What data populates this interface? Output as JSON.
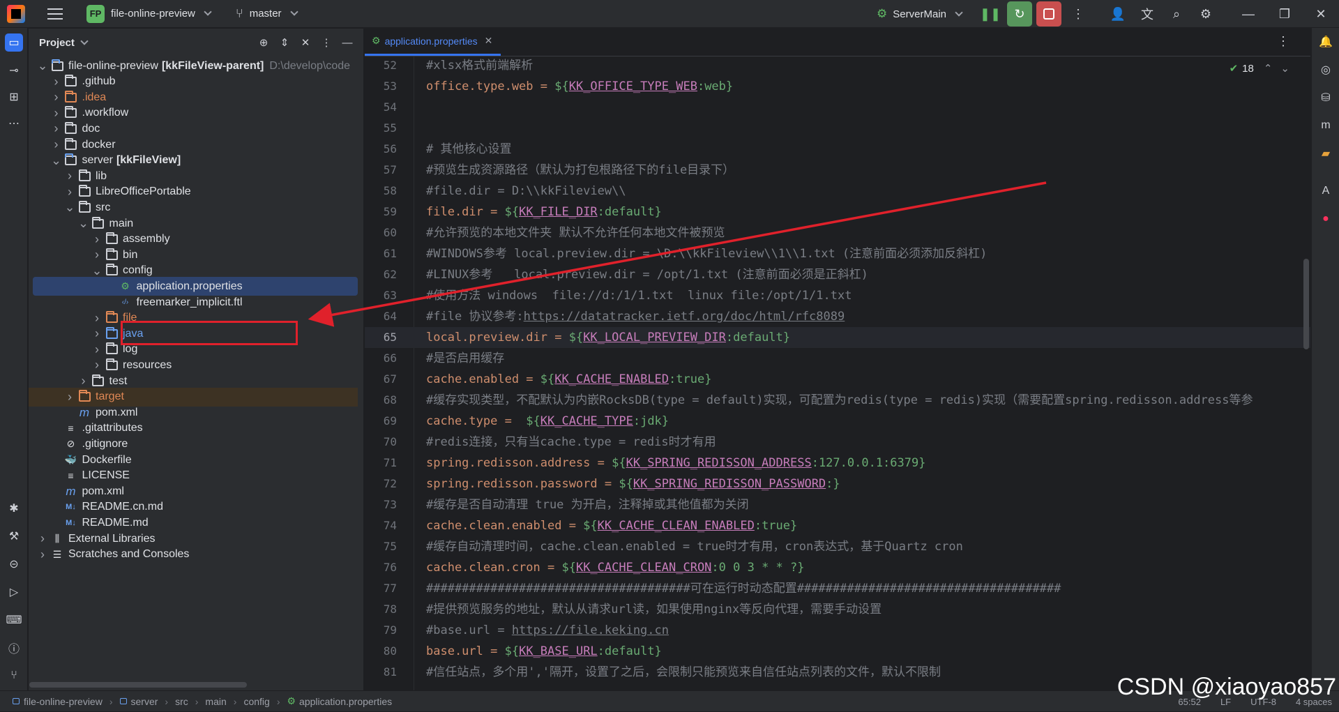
{
  "titlebar": {
    "project_badge": "FP",
    "project_name": "file-online-preview",
    "branch": "master",
    "run_config": "ServerMain"
  },
  "project_panel": {
    "title": "Project",
    "tree": [
      {
        "label": "file-online-preview",
        "bold": "[kkFileView-parent]",
        "path": "D:\\develop\\code",
        "level": 0,
        "expanded": true,
        "icon": "module-folder"
      },
      {
        "label": ".github",
        "level": 1,
        "icon": "folder"
      },
      {
        "label": ".idea",
        "level": 1,
        "icon": "folder",
        "color": "#e08855"
      },
      {
        "label": ".workflow",
        "level": 1,
        "icon": "folder"
      },
      {
        "label": "doc",
        "level": 1,
        "icon": "folder"
      },
      {
        "label": "docker",
        "level": 1,
        "icon": "folder"
      },
      {
        "label": "server",
        "bold": "[kkFileView]",
        "level": 1,
        "expanded": true,
        "icon": "module-folder"
      },
      {
        "label": "lib",
        "level": 2,
        "icon": "folder"
      },
      {
        "label": "LibreOfficePortable",
        "level": 2,
        "icon": "folder"
      },
      {
        "label": "src",
        "level": 2,
        "expanded": true,
        "icon": "folder"
      },
      {
        "label": "main",
        "level": 3,
        "expanded": true,
        "icon": "folder"
      },
      {
        "label": "assembly",
        "level": 4,
        "icon": "folder"
      },
      {
        "label": "bin",
        "level": 4,
        "icon": "folder"
      },
      {
        "label": "config",
        "level": 4,
        "expanded": true,
        "icon": "resource-folder"
      },
      {
        "label": "application.properties",
        "level": 5,
        "icon": "properties-file",
        "selected": true,
        "leaf": true
      },
      {
        "label": "freemarker_implicit.ftl",
        "level": 5,
        "icon": "ftl-file",
        "leaf": true
      },
      {
        "label": "file",
        "level": 4,
        "icon": "folder",
        "color": "#e08855"
      },
      {
        "label": "java",
        "level": 4,
        "icon": "folder",
        "color": "#6aa1f0"
      },
      {
        "label": "log",
        "level": 4,
        "icon": "folder"
      },
      {
        "label": "resources",
        "level": 4,
        "icon": "resource-folder"
      },
      {
        "label": "test",
        "level": 3,
        "icon": "folder"
      },
      {
        "label": "target",
        "level": 2,
        "icon": "folder",
        "color": "#e08855",
        "excluded": true
      },
      {
        "label": "pom.xml",
        "level": 2,
        "icon": "maven-file",
        "leaf": true
      },
      {
        "label": ".gitattributes",
        "level": 1,
        "icon": "text-file",
        "leaf": true
      },
      {
        "label": ".gitignore",
        "level": 1,
        "icon": "ignore-file",
        "leaf": true
      },
      {
        "label": "Dockerfile",
        "level": 1,
        "icon": "docker-file",
        "leaf": true
      },
      {
        "label": "LICENSE",
        "level": 1,
        "icon": "text-file",
        "leaf": true
      },
      {
        "label": "pom.xml",
        "level": 1,
        "icon": "maven-file",
        "leaf": true
      },
      {
        "label": "README.cn.md",
        "level": 1,
        "icon": "markdown-file",
        "leaf": true
      },
      {
        "label": "README.md",
        "level": 1,
        "icon": "markdown-file",
        "leaf": true
      },
      {
        "label": "External Libraries",
        "level": 0,
        "icon": "libraries"
      },
      {
        "label": "Scratches and Consoles",
        "level": 0,
        "icon": "scratches"
      }
    ]
  },
  "editor": {
    "tab_label": "application.properties",
    "inspections_count": "18",
    "current_line": 65,
    "lines": [
      {
        "n": "52",
        "segs": [
          [
            "c",
            "#xlsx格式前端解析"
          ]
        ]
      },
      {
        "n": "53",
        "segs": [
          [
            "k",
            "office.type.web = "
          ],
          [
            "v",
            "${"
          ],
          [
            "e",
            "KK_OFFICE_TYPE_WEB"
          ],
          [
            "v",
            ":web}"
          ]
        ]
      },
      {
        "n": "54",
        "segs": []
      },
      {
        "n": "55",
        "segs": []
      },
      {
        "n": "56",
        "segs": [
          [
            "c",
            "# 其他核心设置"
          ]
        ]
      },
      {
        "n": "57",
        "segs": [
          [
            "c",
            "#预览生成资源路径（默认为打包根路径下的file目录下）"
          ]
        ]
      },
      {
        "n": "58",
        "segs": [
          [
            "c",
            "#file.dir = D:\\\\kkFileview\\\\"
          ]
        ]
      },
      {
        "n": "59",
        "segs": [
          [
            "k",
            "file.dir = "
          ],
          [
            "v",
            "${"
          ],
          [
            "e",
            "KK_FILE_DIR"
          ],
          [
            "v",
            ":default}"
          ]
        ]
      },
      {
        "n": "60",
        "segs": [
          [
            "c",
            "#允许预览的本地文件夹 默认不允许任何本地文件被预览"
          ]
        ]
      },
      {
        "n": "61",
        "segs": [
          [
            "c",
            "#WINDOWS参考 local.preview.dir = \\D:\\\\kkFileview\\\\1\\\\1.txt (注意前面必须添加反斜杠)"
          ]
        ]
      },
      {
        "n": "62",
        "segs": [
          [
            "c",
            "#LINUX参考   local.preview.dir = /opt/1.txt (注意前面必须是正斜杠)"
          ]
        ]
      },
      {
        "n": "63",
        "segs": [
          [
            "c",
            "#使用方法 windows  file://d:/1/1.txt  linux file:/opt/1/1.txt"
          ]
        ]
      },
      {
        "n": "64",
        "segs": [
          [
            "c",
            "#file 协议参考:"
          ],
          [
            "u",
            "https://datatracker.ietf.org/doc/html/rfc8089"
          ]
        ]
      },
      {
        "n": "65",
        "segs": [
          [
            "k",
            "local.preview.dir = "
          ],
          [
            "v",
            "${"
          ],
          [
            "e",
            "KK_LOCAL_PREVIEW_DIR"
          ],
          [
            "v",
            ":default}"
          ]
        ]
      },
      {
        "n": "66",
        "segs": [
          [
            "c",
            "#是否启用缓存"
          ]
        ]
      },
      {
        "n": "67",
        "segs": [
          [
            "k",
            "cache.enabled = "
          ],
          [
            "v",
            "${"
          ],
          [
            "e",
            "KK_CACHE_ENABLED"
          ],
          [
            "v",
            ":true}"
          ]
        ]
      },
      {
        "n": "68",
        "segs": [
          [
            "c",
            "#缓存实现类型，不配默认为内嵌RocksDB(type = default)实现，可配置为redis(type = redis)实现（需要配置spring.redisson.address等参"
          ]
        ]
      },
      {
        "n": "69",
        "segs": [
          [
            "k",
            "cache.type =  "
          ],
          [
            "v",
            "${"
          ],
          [
            "e",
            "KK_CACHE_TYPE"
          ],
          [
            "v",
            ":jdk}"
          ]
        ]
      },
      {
        "n": "70",
        "segs": [
          [
            "c",
            "#redis连接，只有当cache.type = redis时才有用"
          ]
        ]
      },
      {
        "n": "71",
        "segs": [
          [
            "k",
            "spring.redisson.address = "
          ],
          [
            "v",
            "${"
          ],
          [
            "e",
            "KK_SPRING_REDISSON_ADDRESS"
          ],
          [
            "v",
            ":127.0.0.1:6379}"
          ]
        ]
      },
      {
        "n": "72",
        "segs": [
          [
            "k",
            "spring.redisson.password = "
          ],
          [
            "v",
            "${"
          ],
          [
            "e",
            "KK_SPRING_REDISSON_PASSWORD"
          ],
          [
            "v",
            ":}"
          ]
        ]
      },
      {
        "n": "73",
        "segs": [
          [
            "c",
            "#缓存是否自动清理 true 为开启，注释掉或其他值都为关闭"
          ]
        ]
      },
      {
        "n": "74",
        "segs": [
          [
            "k",
            "cache.clean.enabled = "
          ],
          [
            "v",
            "${"
          ],
          [
            "e",
            "KK_CACHE_CLEAN_ENABLED"
          ],
          [
            "v",
            ":true}"
          ]
        ]
      },
      {
        "n": "75",
        "segs": [
          [
            "c",
            "#缓存自动清理时间，cache.clean.enabled = true时才有用，cron表达式，基于Quartz cron"
          ]
        ]
      },
      {
        "n": "76",
        "segs": [
          [
            "k",
            "cache.clean.cron = "
          ],
          [
            "v",
            "${"
          ],
          [
            "e",
            "KK_CACHE_CLEAN_CRON"
          ],
          [
            "v",
            ":0 0 3 * * ?}"
          ]
        ]
      },
      {
        "n": "77",
        "segs": [
          [
            "c",
            "#####################################可在运行时动态配置#####################################"
          ]
        ]
      },
      {
        "n": "78",
        "segs": [
          [
            "c",
            "#提供预览服务的地址，默认从请求url读，如果使用nginx等反向代理，需要手动设置"
          ]
        ]
      },
      {
        "n": "79",
        "segs": [
          [
            "c",
            "#base.url = "
          ],
          [
            "u",
            "https://file.keking.cn"
          ]
        ]
      },
      {
        "n": "80",
        "segs": [
          [
            "k",
            "base.url = "
          ],
          [
            "v",
            "${"
          ],
          [
            "e",
            "KK_BASE_URL"
          ],
          [
            "v",
            ":default}"
          ]
        ]
      },
      {
        "n": "81",
        "segs": [
          [
            "c",
            "#信任站点，多个用','隔开，设置了之后，会限制只能预览来自信任站点列表的文件，默认不限制"
          ]
        ]
      }
    ]
  },
  "statusbar": {
    "breadcrumb": [
      "file-online-preview",
      "server",
      "src",
      "main",
      "config",
      "application.properties"
    ],
    "position": "65:52",
    "line_sep": "LF",
    "encoding": "UTF-8",
    "indent": "4 spaces"
  },
  "watermark": "CSDN @xiaoyao857",
  "colors": {
    "accent": "#3574f0",
    "annotation": "#e0212b",
    "key": "#cf8e6d",
    "comment": "#7a7e85",
    "value": "#6aab73",
    "env": "#c77dbb"
  }
}
